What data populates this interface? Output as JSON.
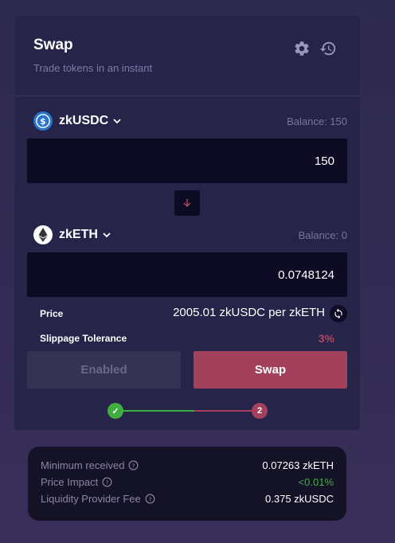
{
  "header": {
    "title": "Swap",
    "subtitle": "Trade tokens in an instant"
  },
  "icons": {
    "settings": "gear-icon",
    "history": "history-icon"
  },
  "from": {
    "token": "zkUSDC",
    "balance_label": "Balance: 150",
    "amount": "150",
    "logo": "usdc-logo-icon"
  },
  "to": {
    "token": "zkETH",
    "balance_label": "Balance: 0",
    "amount": "0.0748124",
    "logo": "eth-logo-icon"
  },
  "info": {
    "price_label": "Price",
    "price_value": "2005.01 zkUSDC per zkETH",
    "slippage_label": "Slippage Tolerance",
    "slippage_value": "3%"
  },
  "buttons": {
    "enabled_label": "Enabled",
    "swap_label": "Swap"
  },
  "steps": {
    "step1": "✓",
    "step2": "2"
  },
  "summary": {
    "min_received_label": "Minimum received",
    "min_received_value": "0.07263 zkETH",
    "price_impact_label": "Price Impact",
    "price_impact_value": "<0.01%",
    "lp_fee_label": "Liquidity Provider Fee",
    "lp_fee_value": "0.375 zkUSDC"
  },
  "colors": {
    "accent": "#a3405c",
    "step_done": "#3fae3f",
    "price_impact": "#3fae3f",
    "slippage": "#b0465f",
    "card": "#262449",
    "input": "#0d0b24"
  }
}
